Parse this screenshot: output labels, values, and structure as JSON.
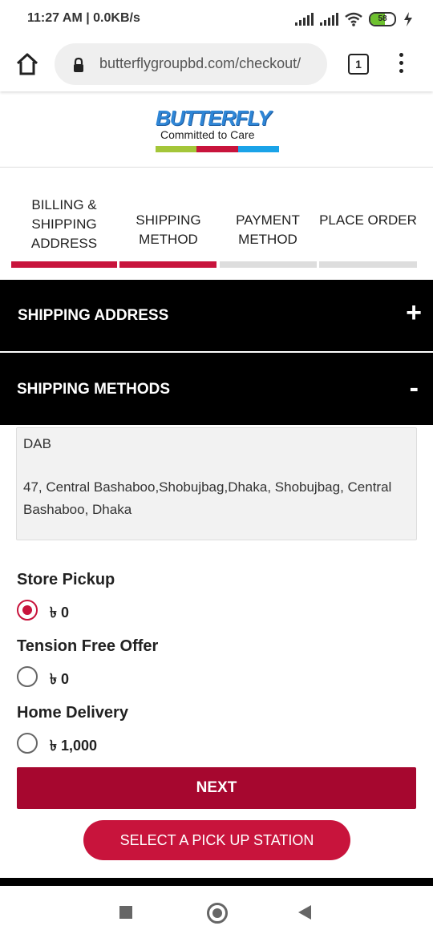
{
  "status_bar": {
    "time": "11:27 AM | 0.0KB/s",
    "battery": "58",
    "icons": [
      "signal-icon",
      "signal-icon",
      "wifi-icon",
      "battery-icon",
      "charging-icon"
    ]
  },
  "browser": {
    "url": "butterflygroupbd.com/checkout/",
    "tab_count": "1"
  },
  "logo": {
    "word": "BUTTERFLY",
    "tagline": "Committed to Care",
    "stripe_colors": [
      "#a4c639",
      "#c8143c",
      "#1aa3e8"
    ]
  },
  "steps": [
    {
      "label": "BILLING & SHIPPING ADDRESS",
      "state": "complete"
    },
    {
      "label": "SHIPPING METHOD",
      "state": "complete"
    },
    {
      "label": "PAYMENT METHOD",
      "state": "pending"
    },
    {
      "label": "PLACE ORDER",
      "state": "pending"
    }
  ],
  "accordion": {
    "shipping_address": {
      "title": "SHIPPING ADDRESS",
      "toggle": "+"
    },
    "shipping_methods": {
      "title": "SHIPPING METHODS",
      "toggle": "-"
    }
  },
  "address": {
    "name": "DAB",
    "line": "47, Central Bashaboo,Shobujbag,Dhaka, Shobujbag, Central Bashaboo, Dhaka"
  },
  "shipping_options": [
    {
      "title": "Store Pickup",
      "price": "৳ 0",
      "selected": true
    },
    {
      "title": "Tension Free Offer",
      "price": "৳ 0",
      "selected": false
    },
    {
      "title": "Home Delivery",
      "price": "৳ 1,000",
      "selected": false
    }
  ],
  "buttons": {
    "next": "NEXT",
    "pickup": "SELECT A PICK UP STATION"
  },
  "colors": {
    "accent": "#c8143c",
    "next_button": "#a6072f",
    "step_complete": "#c8143c",
    "step_pending": "#dddddd"
  }
}
